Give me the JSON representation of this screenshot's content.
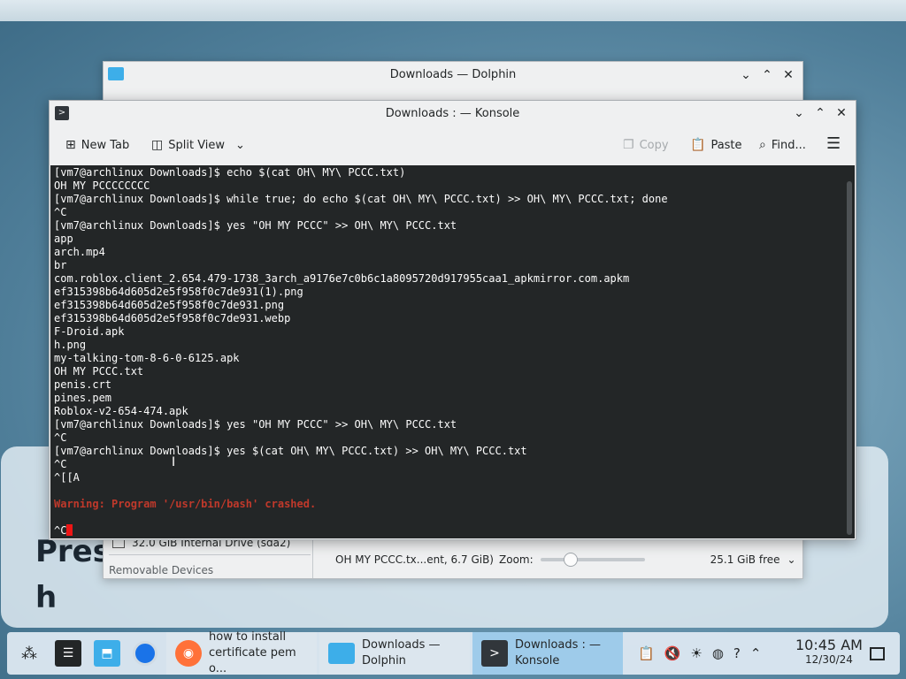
{
  "desktop": {
    "bg_text_line1": "Pres",
    "bg_text_line2": "h"
  },
  "dolphin": {
    "title": "Downloads — Dolphin",
    "sidebar_drive": "32.0 GiB Internal Drive (sda2)",
    "sidebar_section": "Removable Devices",
    "status_file": "OH MY PCCC.tx...ent, 6.7 GiB)",
    "zoom_label": "Zoom:",
    "free_space": "25.1 GiB free"
  },
  "konsole": {
    "title": "Downloads : — Konsole",
    "toolbar": {
      "new_tab": "New Tab",
      "split_view": "Split View",
      "copy": "Copy",
      "paste": "Paste",
      "find": "Find..."
    },
    "terminal_lines": [
      "[vm7@archlinux Downloads]$ echo $(cat OH\\ MY\\ PCCC.txt)",
      "OH MY PCCCCCCCC",
      "[vm7@archlinux Downloads]$ while true; do echo $(cat OH\\ MY\\ PCCC.txt) >> OH\\ MY\\ PCCC.txt; done",
      "^C",
      "[vm7@archlinux Downloads]$ yes \"OH MY PCCC\" >> OH\\ MY\\ PCCC.txt",
      "app",
      "arch.mp4",
      "br",
      "com.roblox.client_2.654.479-1738_3arch_a9176e7c0b6c1a8095720d917955caa1_apkmirror.com.apkm",
      "ef315398b64d605d2e5f958f0c7de931(1).png",
      "ef315398b64d605d2e5f958f0c7de931.png",
      "ef315398b64d605d2e5f958f0c7de931.webp",
      "F-Droid.apk",
      "h.png",
      "my-talking-tom-8-6-0-6125.apk",
      "OH MY PCCC.txt",
      "penis.crt",
      "pines.pem",
      "Roblox-v2-654-474.apk",
      "[vm7@archlinux Downloads]$ yes \"OH MY PCCC\" >> OH\\ MY\\ PCCC.txt",
      "^C",
      "[vm7@archlinux Downloads]$ yes $(cat OH\\ MY\\ PCCC.txt) >> OH\\ MY\\ PCCC.txt",
      "^C",
      "^[[A"
    ],
    "warning": "Warning: Program '/usr/bin/bash' crashed.",
    "prompt_tail": "^C"
  },
  "taskbar": {
    "tasks": [
      {
        "label": "how to install certificate pem o..."
      },
      {
        "label": "Downloads — Dolphin"
      },
      {
        "label": "Downloads : — Konsole"
      }
    ],
    "clock_time": "10:45 AM",
    "clock_date": "12/30/24"
  }
}
